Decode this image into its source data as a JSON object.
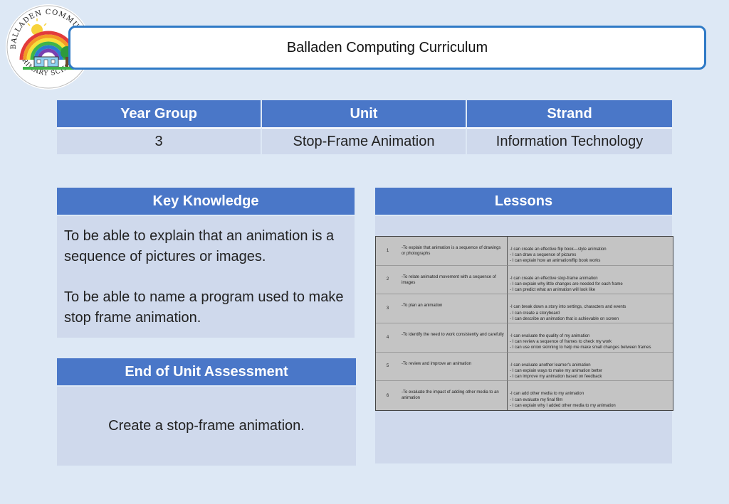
{
  "header": {
    "title": "Balladen Computing Curriculum",
    "logo_text_top": "BALLADEN COMMUNITY",
    "logo_text_bottom": "PRIMARY SCHOOL"
  },
  "info": {
    "headers": [
      "Year Group",
      "Unit",
      "Strand"
    ],
    "values": [
      "3",
      "Stop-Frame Animation",
      "Information Technology"
    ]
  },
  "key_knowledge": {
    "title": "Key Knowledge",
    "points": [
      "To be able to explain that an animation is a sequence of pictures or images.",
      "To be able to name a program used to make stop frame animation."
    ]
  },
  "assessment": {
    "title": "End of Unit Assessment",
    "text": "Create a stop-frame animation."
  },
  "lessons": {
    "title": "Lessons",
    "rows": [
      {
        "number": "1",
        "objective": "-To explain that animation is a sequence of drawings or photographs",
        "outcomes": [
          "-I can create an effective flip book—style animation",
          "- I can draw a sequence of pictures",
          "- I can explain how an animation/flip book works"
        ]
      },
      {
        "number": "2",
        "objective": "-To relate animated movement with a sequence of images",
        "outcomes": [
          "-I can create an effective stop-frame animation",
          "- I can explain why little changes are needed for each frame",
          "- I can predict what an animation will look like"
        ]
      },
      {
        "number": "3",
        "objective": "-To plan an animation",
        "outcomes": [
          "-I can break down a story into settings, characters and events",
          "- I can create a storyboard",
          "- I can describe an animation that is achievable on screen"
        ]
      },
      {
        "number": "4",
        "objective": "-To identify the need to work consistently and carefully",
        "outcomes": [
          "-I can evaluate the quality of my animation",
          "- I can review a sequence of frames to check my work",
          "- I can use onion skinning to help me make small changes between frames"
        ]
      },
      {
        "number": "5",
        "objective": "-To review and improve an animation",
        "outcomes": [
          "-I can evaluate another learner's animation",
          "- I can explain ways to make my animation better",
          "- I can improve my animation based on feedback"
        ]
      },
      {
        "number": "6",
        "objective": "-To evaluate the impact of adding other media to an animation",
        "outcomes": [
          "-I can add other media to my animation",
          "- I can evaluate my final film",
          "- I can explain why I added other media to my animation"
        ]
      }
    ]
  }
}
